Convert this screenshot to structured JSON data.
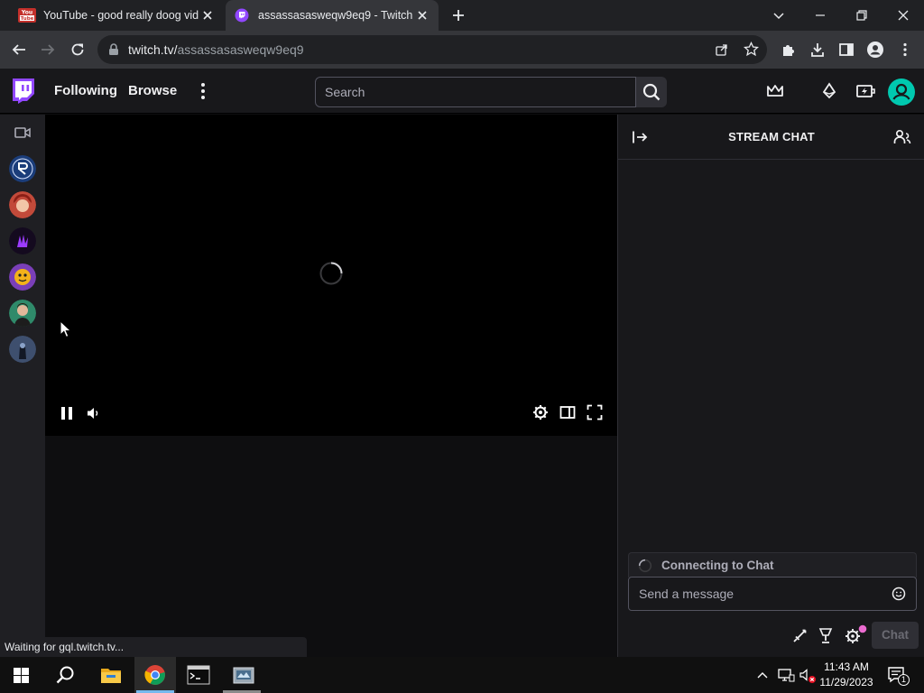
{
  "browser": {
    "tabs": [
      {
        "title": "YouTube - good really doog video"
      },
      {
        "title": "assassasasweqw9eq9 - Twitch"
      }
    ],
    "url_host": "twitch.tv/",
    "url_path": "assassasasweqw9eq9"
  },
  "twitch": {
    "nav": {
      "following": "Following",
      "browse": "Browse",
      "search_placeholder": "Search"
    },
    "chat": {
      "title": "STREAM CHAT",
      "connecting": "Connecting to Chat",
      "input_placeholder": "Send a message",
      "chat_button": "Chat"
    },
    "status": "Waiting for gql.twitch.tv..."
  },
  "taskbar": {
    "time": "11:43 AM",
    "date": "11/29/2023",
    "notification_count": "1"
  },
  "colors": {
    "twitch_purple": "#9147ff",
    "avatar_green": "#00c8af"
  }
}
